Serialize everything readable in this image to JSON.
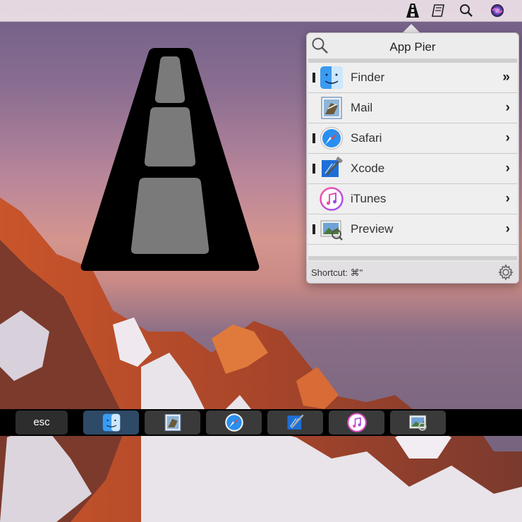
{
  "menubar": {
    "icons": [
      "app-pier-icon",
      "script-icon",
      "search-icon",
      "siri-icon"
    ]
  },
  "popover": {
    "title": "App Pier",
    "apps": [
      {
        "name": "Finder",
        "icon": "finder-icon",
        "running": true,
        "chevron": "»"
      },
      {
        "name": "Mail",
        "icon": "mail-icon",
        "running": false,
        "chevron": "›"
      },
      {
        "name": "Safari",
        "icon": "safari-icon",
        "running": true,
        "chevron": "›"
      },
      {
        "name": "Xcode",
        "icon": "xcode-icon",
        "running": true,
        "chevron": "›"
      },
      {
        "name": "iTunes",
        "icon": "itunes-icon",
        "running": false,
        "chevron": "›"
      },
      {
        "name": "Preview",
        "icon": "preview-icon",
        "running": true,
        "chevron": "›"
      }
    ],
    "shortcut": "Shortcut: ⌘\""
  },
  "touchbar": {
    "esc_label": "esc",
    "apps": [
      "finder-icon",
      "mail-icon",
      "safari-icon",
      "xcode-icon",
      "itunes-icon",
      "preview-icon"
    ]
  }
}
